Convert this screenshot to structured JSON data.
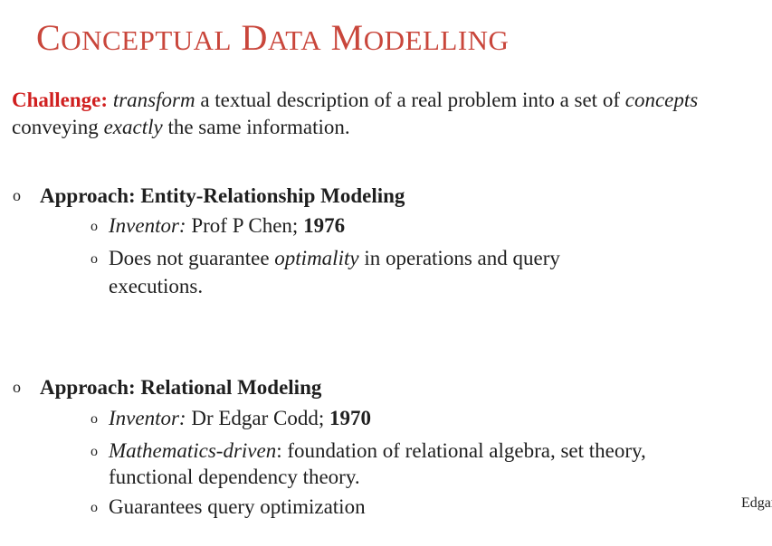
{
  "slide": {
    "title": {
      "w1_first": "C",
      "w1_rest": "ONCEPTUAL",
      "w2_first": "D",
      "w2_rest": "ATA",
      "w3_first": "M",
      "w3_rest": "ODELLING"
    },
    "challenge": {
      "label": "Challenge:",
      "em1": "transform",
      "t1": " a textual description of a real problem into a set of ",
      "em2": "concepts",
      "t2": " conveying ",
      "em3": "exactly",
      "t3": " the same information."
    },
    "bullet_glyph": "o",
    "er": {
      "heading": "Approach: Entity-Relationship Modeling",
      "inventor_label": "Inventor:",
      "inventor_name": " Prof P Chen; ",
      "inventor_year": "1976",
      "note_t1": "Does not guarantee ",
      "note_em": "optimality",
      "note_t2": " in operations and query",
      "note_t3": "executions."
    },
    "rel": {
      "heading": "Approach: Relational Modeling",
      "inventor_label": "Inventor:",
      "inventor_name": " Dr Edgar Codd;  ",
      "inventor_year": "1970",
      "math_em": "Mathematics-driven",
      "math_t1": ": foundation of relational algebra, set theory,",
      "math_t2": "functional dependency theory.",
      "guarantee": "Guarantees query optimization"
    },
    "footer": "Edgar"
  }
}
